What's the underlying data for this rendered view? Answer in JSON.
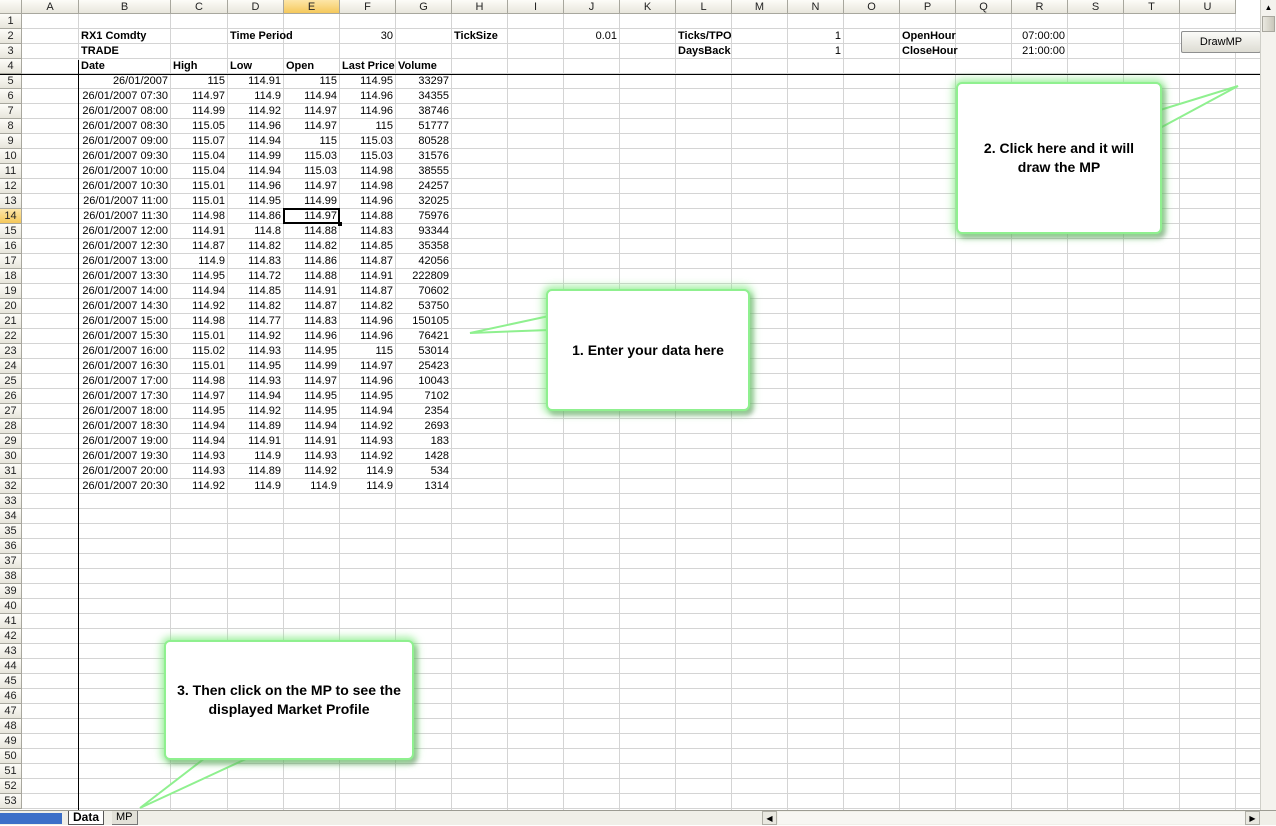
{
  "columns": [
    "A",
    "B",
    "C",
    "D",
    "E",
    "F",
    "G",
    "H",
    "I",
    "J",
    "K",
    "L",
    "M",
    "N",
    "O",
    "P",
    "Q",
    "R",
    "S",
    "T",
    "U"
  ],
  "row_count": 53,
  "active_cell": "E14",
  "header": {
    "ticker": "RX1 Comdty",
    "field": "TRADE",
    "time_period_label": "Time Period",
    "time_period_value": "30",
    "ticksize_label": "TickSize",
    "ticksize_value": "0.01",
    "ticks_tpo_label": "Ticks/TPO",
    "ticks_tpo_value": "1",
    "daysback_label": "DaysBack",
    "daysback_value": "1",
    "openhour_label": "OpenHour",
    "openhour_value": "07:00:00",
    "closehour_label": "CloseHour",
    "closehour_value": "21:00:00"
  },
  "table": {
    "headers": [
      "Date",
      "High",
      "Low",
      "Open",
      "Last Price",
      "Volume"
    ],
    "rows": [
      [
        "26/01/2007",
        "115",
        "114.91",
        "115",
        "114.95",
        "33297"
      ],
      [
        "26/01/2007 07:30",
        "114.97",
        "114.9",
        "114.94",
        "114.96",
        "34355"
      ],
      [
        "26/01/2007 08:00",
        "114.99",
        "114.92",
        "114.97",
        "114.96",
        "38746"
      ],
      [
        "26/01/2007 08:30",
        "115.05",
        "114.96",
        "114.97",
        "115",
        "51777"
      ],
      [
        "26/01/2007 09:00",
        "115.07",
        "114.94",
        "115",
        "115.03",
        "80528"
      ],
      [
        "26/01/2007 09:30",
        "115.04",
        "114.99",
        "115.03",
        "115.03",
        "31576"
      ],
      [
        "26/01/2007 10:00",
        "115.04",
        "114.94",
        "115.03",
        "114.98",
        "38555"
      ],
      [
        "26/01/2007 10:30",
        "115.01",
        "114.96",
        "114.97",
        "114.98",
        "24257"
      ],
      [
        "26/01/2007 11:00",
        "115.01",
        "114.95",
        "114.99",
        "114.96",
        "32025"
      ],
      [
        "26/01/2007 11:30",
        "114.98",
        "114.86",
        "114.97",
        "114.88",
        "75976"
      ],
      [
        "26/01/2007 12:00",
        "114.91",
        "114.8",
        "114.88",
        "114.83",
        "93344"
      ],
      [
        "26/01/2007 12:30",
        "114.87",
        "114.82",
        "114.82",
        "114.85",
        "35358"
      ],
      [
        "26/01/2007 13:00",
        "114.9",
        "114.83",
        "114.86",
        "114.87",
        "42056"
      ],
      [
        "26/01/2007 13:30",
        "114.95",
        "114.72",
        "114.88",
        "114.91",
        "222809"
      ],
      [
        "26/01/2007 14:00",
        "114.94",
        "114.85",
        "114.91",
        "114.87",
        "70602"
      ],
      [
        "26/01/2007 14:30",
        "114.92",
        "114.82",
        "114.87",
        "114.82",
        "53750"
      ],
      [
        "26/01/2007 15:00",
        "114.98",
        "114.77",
        "114.83",
        "114.96",
        "150105"
      ],
      [
        "26/01/2007 15:30",
        "115.01",
        "114.92",
        "114.96",
        "114.96",
        "76421"
      ],
      [
        "26/01/2007 16:00",
        "115.02",
        "114.93",
        "114.95",
        "115",
        "53014"
      ],
      [
        "26/01/2007 16:30",
        "115.01",
        "114.95",
        "114.99",
        "114.97",
        "25423"
      ],
      [
        "26/01/2007 17:00",
        "114.98",
        "114.93",
        "114.97",
        "114.96",
        "10043"
      ],
      [
        "26/01/2007 17:30",
        "114.97",
        "114.94",
        "114.95",
        "114.95",
        "7102"
      ],
      [
        "26/01/2007 18:00",
        "114.95",
        "114.92",
        "114.95",
        "114.94",
        "2354"
      ],
      [
        "26/01/2007 18:30",
        "114.94",
        "114.89",
        "114.94",
        "114.92",
        "2693"
      ],
      [
        "26/01/2007 19:00",
        "114.94",
        "114.91",
        "114.91",
        "114.93",
        "183"
      ],
      [
        "26/01/2007 19:30",
        "114.93",
        "114.9",
        "114.93",
        "114.92",
        "1428"
      ],
      [
        "26/01/2007 20:00",
        "114.93",
        "114.89",
        "114.92",
        "114.9",
        "534"
      ],
      [
        "26/01/2007 20:30",
        "114.92",
        "114.9",
        "114.9",
        "114.9",
        "1314"
      ]
    ]
  },
  "button": {
    "draw_label": "DrawMP"
  },
  "callouts": {
    "enter_data": "1. Enter your data here",
    "click_here": "2. Click here and it will draw the MP",
    "view_mp": "3. Then click on the MP to see the displayed Market Profile"
  },
  "tabs": [
    "Data",
    "MP"
  ],
  "colors": {
    "callout_border": "#8ff08f",
    "header_selected": "#f5c85b",
    "gridline": "#d4d4d4"
  }
}
